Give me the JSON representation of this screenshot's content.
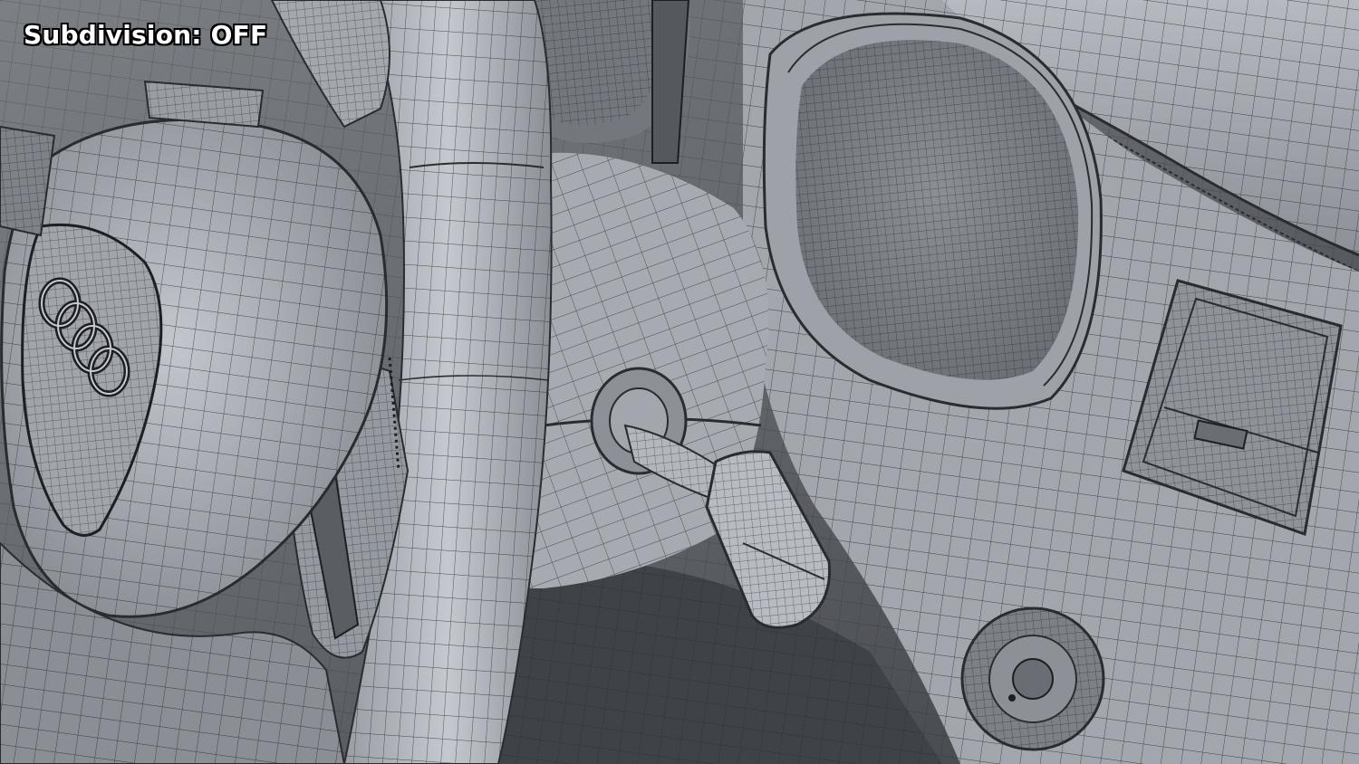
{
  "overlay": {
    "subdivision_label": "Subdivision: OFF"
  },
  "render": {
    "subject": "wireframe-car-interior-steering-wheel",
    "colors": {
      "surface_light": "#b9bdc3",
      "surface_mid": "#8e9298",
      "surface_dark": "#4b4e53",
      "wire": "#1d1f22",
      "label_fill": "#ffffff",
      "label_outline": "#000000"
    }
  }
}
